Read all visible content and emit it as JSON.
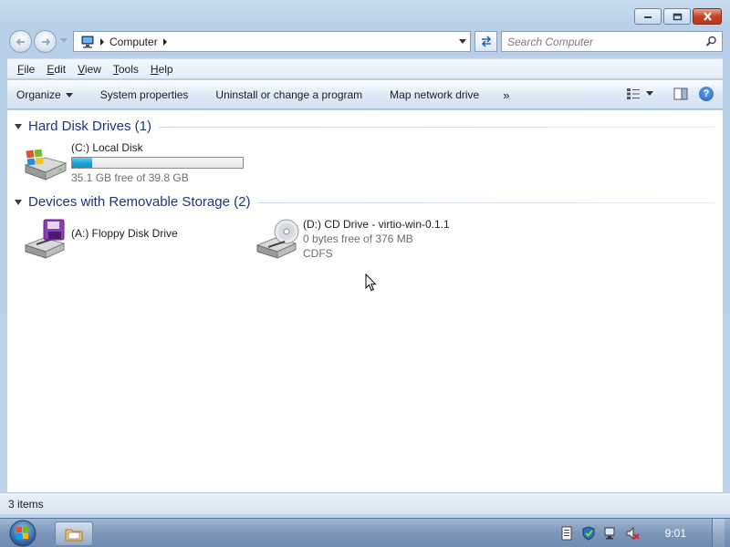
{
  "window": {
    "caption_buttons": [
      "minimize-icon",
      "maximize-icon",
      "close-icon"
    ]
  },
  "address_bar": {
    "breadcrumb": [
      "Computer"
    ],
    "search_placeholder": "Search Computer"
  },
  "menu": {
    "items": [
      "File",
      "Edit",
      "View",
      "Tools",
      "Help"
    ]
  },
  "command_bar": {
    "organize": "Organize",
    "system_properties": "System properties",
    "uninstall": "Uninstall or change a program",
    "map_network_drive": "Map network drive",
    "more": "»"
  },
  "groups": [
    {
      "title": "Hard Disk Drives (1)",
      "drives": [
        {
          "name": "(C:) Local Disk",
          "free_text": "35.1 GB free of 39.8 GB",
          "used_fraction": 0.118,
          "icon": "windows-hard-disk-icon"
        }
      ]
    },
    {
      "title": "Devices with Removable Storage (2)",
      "drives": [
        {
          "name": "(A:) Floppy Disk Drive",
          "icon": "floppy-drive-icon"
        },
        {
          "name": "(D:) CD Drive - virtio-win-0.1.1",
          "free_text": "0 bytes free of 376 MB",
          "filesystem": "CDFS",
          "icon": "cd-drive-icon"
        }
      ]
    }
  ],
  "status_bar": {
    "item_count": "3 items"
  },
  "taskbar": {
    "clock": "9:01",
    "tray_icons": [
      "action-center-icon",
      "security-icon",
      "network-icon",
      "volume-muted-icon"
    ]
  },
  "colors": {
    "group_title": "#1e3287",
    "capacity_fill": "#1aa1d8"
  }
}
